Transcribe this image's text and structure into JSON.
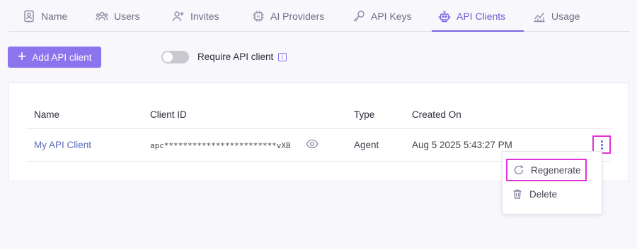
{
  "tabs": [
    {
      "label": "Name",
      "icon": "contact-card-icon",
      "active": false
    },
    {
      "label": "Users",
      "icon": "users-icon",
      "active": false
    },
    {
      "label": "Invites",
      "icon": "user-plus-icon",
      "active": false
    },
    {
      "label": "AI Providers",
      "icon": "chip-icon",
      "active": false
    },
    {
      "label": "API Keys",
      "icon": "key-icon",
      "active": false
    },
    {
      "label": "API Clients",
      "icon": "robot-icon",
      "active": true
    },
    {
      "label": "Usage",
      "icon": "chart-line-icon",
      "active": false
    }
  ],
  "toolbar": {
    "add_label": "Add API client",
    "require_label": "Require API client",
    "require_enabled": false
  },
  "table": {
    "headers": [
      "Name",
      "Client ID",
      "Type",
      "Created On"
    ],
    "rows": [
      {
        "name": "My API Client",
        "client_id": "apc************************vXB",
        "type": "Agent",
        "created_on": "Aug 5 2025 5:43:27 PM"
      }
    ]
  },
  "menu": {
    "items": [
      "Regenerate",
      "Delete"
    ]
  },
  "colors": {
    "accent": "#8b74ee",
    "highlight": "#e033d6"
  }
}
